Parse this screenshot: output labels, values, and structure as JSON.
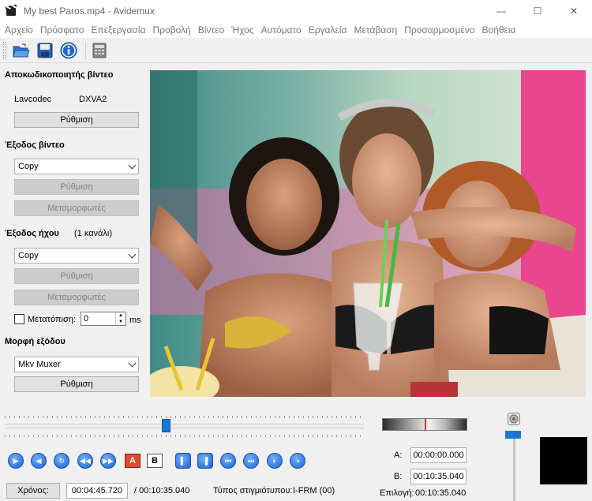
{
  "window": {
    "title": "My best Paros.mp4 - Avidemux",
    "minimize": "—",
    "maximize": "☐",
    "close": "✕"
  },
  "menu": [
    "Αρχείο",
    "Πρόσφατο",
    "Επεξεργασία",
    "Προβολή",
    "Βίντεο",
    "Ήχος",
    "Αυτόματο",
    "Εργαλεία",
    "Μετάβαση",
    "Προσαρμοσμένο",
    "Βοήθεια"
  ],
  "toolbar": {
    "icons": [
      "open-file-icon",
      "save-file-icon",
      "info-icon",
      "calculator-icon"
    ]
  },
  "video_decoder": {
    "title": "Αποκωδικοποιητής βίντεο",
    "decoder_name": "Lavcodec",
    "decoder_hw": "DXVA2",
    "configure": "Ρύθμιση"
  },
  "video_output": {
    "title": "Έξοδος βίντεο",
    "codec": "Copy",
    "configure": "Ρύθμιση",
    "filters": "Μεταμορφωτές"
  },
  "audio_output": {
    "title": "Έξοδος ήχου",
    "channels": "(1 κανάλι)",
    "codec": "Copy",
    "configure": "Ρύθμιση",
    "filters": "Μεταμορφωτές",
    "shift_label": "Μετατόπιση:",
    "shift_value": "0",
    "shift_unit": "ms"
  },
  "output_format": {
    "title": "Μορφή εξόδου",
    "muxer": "Mkv Muxer",
    "configure": "Ρύθμιση"
  },
  "timeline": {
    "position_fraction": 0.45
  },
  "markers": {
    "a_label": "A",
    "b_label": "B"
  },
  "status": {
    "time_button": "Χρόνος:",
    "current_time": "00:04:45.720",
    "total_time": "/ 00:10:35.040",
    "frame_type_label": "Τύπος στιγμιότυπου:",
    "frame_type": "I-FRM (00)",
    "a_label": "A:",
    "a_time": "00:00:00.000",
    "b_label": "B:",
    "b_time": "00:10:35.040",
    "selection_label": "Επιλογή:",
    "selection_time": "00:10:35.040"
  },
  "colors": {
    "accent": "#1a76d2",
    "marker_red": "#d23a2a"
  }
}
